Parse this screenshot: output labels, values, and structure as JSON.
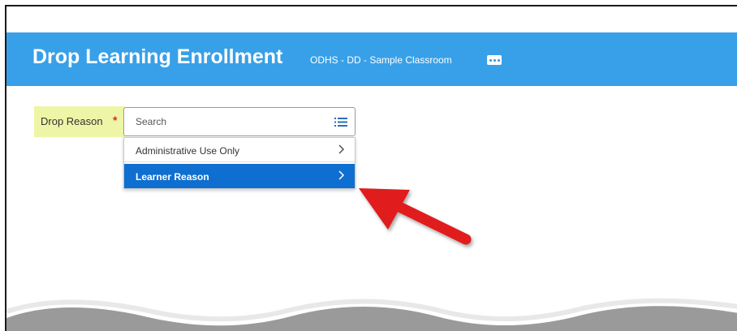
{
  "header": {
    "title": "Drop Learning Enrollment",
    "subtitle": "ODHS - DD - Sample Classroom",
    "more_icon": "ellipsis-icon"
  },
  "field": {
    "label": "Drop Reason",
    "required_mark": "*"
  },
  "search": {
    "placeholder": "Search",
    "icon": "list-icon"
  },
  "dropdown": {
    "items": [
      {
        "label": "Administrative Use Only",
        "selected": false
      },
      {
        "label": "Learner Reason",
        "selected": true
      }
    ]
  },
  "colors": {
    "header_bg": "#38a0e8",
    "label_highlight": "#eef5a6",
    "selected_item": "#0f6fd0",
    "required": "#d62b2b",
    "annotation_arrow": "#e01b1b"
  }
}
